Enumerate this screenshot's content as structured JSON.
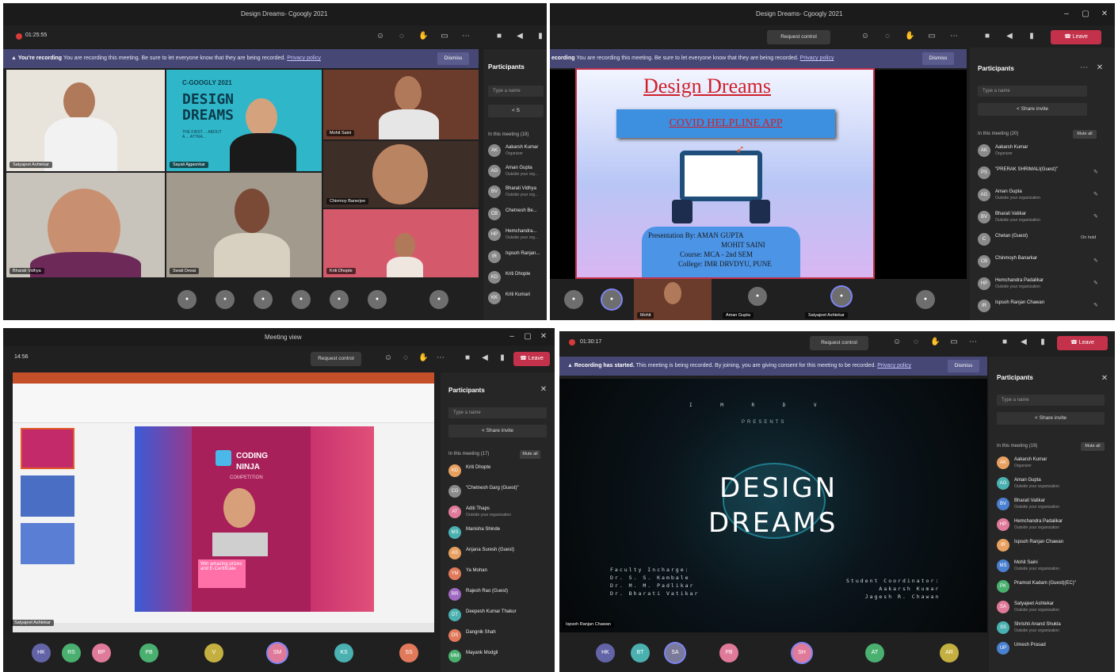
{
  "panel1": {
    "window_title": "Design Dreams- Cgoogly 2021",
    "timer": "01:25:55",
    "banner": {
      "bold": "You're recording",
      "text": "You are recording this meeting. Be sure to let everyone know that they are being recorded.",
      "link": "Privacy policy",
      "dismiss": "Dismiss"
    },
    "tiles": [
      {
        "name": "Satyajeet Ashtekar"
      },
      {
        "name": "Sayali Ajgaonkar",
        "slide_text": "C-GOOGLY 2021",
        "slide_big": "DESIGN DREAMS",
        "slide_small": "THE FIRST ... ABOUT A ... ATTRA..."
      },
      {
        "name": "Mohit Saini"
      },
      {
        "name": "Bharati Vidhya"
      },
      {
        "name": "Swati Desai"
      },
      {
        "name": "Chinmoy Banerjee"
      },
      {
        "name": "Kriti Dhopte"
      }
    ],
    "participants_title": "Participants",
    "search_placeholder": "Type a name",
    "in_meeting": "In this meeting (19)",
    "participants": [
      {
        "name": "Aakarsh Kumar",
        "sub": "Organizer"
      },
      {
        "name": "Aman Gupta",
        "sub": "Outside your org..."
      },
      {
        "name": "Bharati Vidhya",
        "sub": "Outside your org..."
      },
      {
        "name": "Chetnesh Be..."
      },
      {
        "name": "Hemchandra...",
        "sub": "Outside your org..."
      },
      {
        "name": "Ispsoh Ranjan..."
      },
      {
        "name": "Kriti Dhopte"
      },
      {
        "name": "Kriti Kumari"
      }
    ]
  },
  "panel2": {
    "window_title": "Design Dreams- Cgoogly 2021",
    "request_control": "Request control",
    "leave": "Leave",
    "banner": {
      "bold": "ecording",
      "text": "You are recording this meeting. Be sure to let everyone know that they are being recorded.",
      "link": "Privacy policy",
      "dismiss": "Dismiss"
    },
    "slide": {
      "title": "Design Dreams",
      "subtitle": "COVID HELPLINE APP",
      "presentation_by_label": "Presentation By:",
      "presenter1": "AMAN GUPTA",
      "presenter2": "MOHIT SAINI",
      "course_label": "Course:",
      "course": "MCA - 2nd SEM",
      "college_label": "College:",
      "college": "IMR DRVDYU, PUNE"
    },
    "participants_title": "Participants",
    "search_placeholder": "Type a name",
    "share_invite": "Share invite",
    "in_meeting": "In this meeting (20)",
    "mute_all": "Mute all",
    "participants": [
      {
        "name": "Aakarsh Kumar",
        "sub": "Organizer"
      },
      {
        "name": "\"PRERAK SHRIMALI(Guest)\""
      },
      {
        "name": "Aman Gupta",
        "sub": "Outside your organization"
      },
      {
        "name": "Bharati Vatikar",
        "sub": "Outside your organization"
      },
      {
        "name": "Chetan (Guest)",
        "tag": "On hold"
      },
      {
        "name": "Chinmoyh Banarkar"
      },
      {
        "name": "Hemchandra Padalikar",
        "sub": "Outside your organization"
      },
      {
        "name": "Ispsoh Ranjan Chawan"
      }
    ],
    "strip_names": [
      "Mohit",
      "Aman Gupta",
      "Satyajeet Ashtekar"
    ]
  },
  "panel3": {
    "window_title": "Meeting view",
    "timer": "14:56",
    "request_control": "Request control",
    "leave": "Leave",
    "slide": {
      "line1": "CODING",
      "line2": "NINJA",
      "line3": "COMPETITION",
      "pink_note": "Win amazing prizes and E-Certificate"
    },
    "presenter_tag": "Satyajeet Ashtekar",
    "participants_title": "Participants",
    "search_placeholder": "Type a name",
    "share_invite": "Share invite",
    "in_meeting": "In this meeting (17)",
    "mute_all": "Mute all",
    "participants": [
      {
        "name": "Kriti Dhopte"
      },
      {
        "name": "\"Chetnesh Garg (Guest)\""
      },
      {
        "name": "Aditi Thaps",
        "sub": "Outside your organization"
      },
      {
        "name": "Manisha Shinde"
      },
      {
        "name": "Anjana Suresh (Guest)"
      },
      {
        "name": "Ya Mohan"
      },
      {
        "name": "Rajesh Rao (Guest)"
      },
      {
        "name": "Deepesh Kumar Thakur"
      },
      {
        "name": "Dangnik Shah"
      },
      {
        "name": "Mayank Modgil"
      }
    ],
    "strip": [
      "HK",
      "RS",
      "BP",
      "PB",
      "V",
      "SM",
      "KS",
      "SS"
    ]
  },
  "panel4": {
    "timer": "01:30:17",
    "request_control": "Request control",
    "leave": "Leave",
    "banner": {
      "bold": "Recording has started.",
      "text": "This meeting is being recorded. By joining, you are giving consent for this meeting to be recorded.",
      "link": "Privacy policy",
      "dismiss": "Dismiss"
    },
    "video": {
      "top_letters": "I M R   D V",
      "presents": "PRESENTS",
      "title1": "DESIGN",
      "title2": "DREAMS",
      "faculty_label": "Faculty Incharge:",
      "faculty1": "Dr. S. S. Kambale",
      "faculty2": "Dr. M. M. Padlikar",
      "faculty3": "Dr. Bharati Vatikar",
      "student_label": "Student Coordinator:",
      "student1": "Aakarsh Kumar",
      "student2": "Jagesh R. Chawan"
    },
    "presenter_tag": "Ispsoh Ranjan Chawan",
    "participants_title": "Participants",
    "search_placeholder": "Type a name",
    "share_invite": "Share invite",
    "in_meeting": "In this meeting (19)",
    "mute_all": "Mute all",
    "participants": [
      {
        "name": "Aakarsh Kumar",
        "sub": "Organizer"
      },
      {
        "name": "Aman Gupta",
        "sub": "Outside your organization"
      },
      {
        "name": "Bharati Vatikar",
        "sub": "Outside your organization"
      },
      {
        "name": "Hemchandra Padalikar",
        "sub": "Outside your organization"
      },
      {
        "name": "Ispsoh Ranjan Chawan"
      },
      {
        "name": "Mohit Saini",
        "sub": "Outside your organization"
      },
      {
        "name": "Pramod Kadam (Guest)(EC)\""
      },
      {
        "name": "Satyajeet Ashtekar",
        "sub": "Outside your organization"
      },
      {
        "name": "Shrishti Anand Shukla",
        "sub": "Outside your organization"
      },
      {
        "name": "Umesh Prasad"
      }
    ],
    "strip": [
      "HK",
      "BT",
      "SA",
      "PB",
      "SH",
      "AT",
      "AR"
    ]
  },
  "colors": {
    "banner": "#464775",
    "leave": "#c4314b",
    "accent": "#7f85f5"
  }
}
